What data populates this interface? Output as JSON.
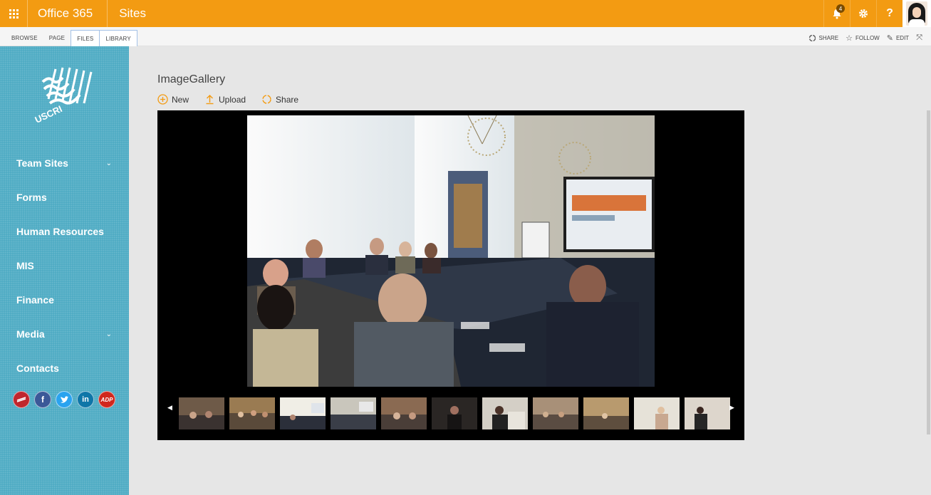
{
  "suitebar": {
    "brand": "Office 365",
    "app": "Sites",
    "notification_count": "4",
    "help_label": "?"
  },
  "ribbon": {
    "tabs": [
      "BROWSE",
      "PAGE",
      "FILES",
      "LIBRARY"
    ],
    "actions": {
      "share": "SHARE",
      "follow": "FOLLOW",
      "edit": "EDIT"
    }
  },
  "leftnav": {
    "logo_text": "USCRI",
    "items": [
      {
        "label": "Team Sites",
        "has_children": true
      },
      {
        "label": "Forms",
        "has_children": false
      },
      {
        "label": "Human Resources",
        "has_children": false
      },
      {
        "label": "MIS",
        "has_children": false
      },
      {
        "label": "Finance",
        "has_children": false
      },
      {
        "label": "Media",
        "has_children": true
      },
      {
        "label": "Contacts",
        "has_children": false
      }
    ],
    "chevron": "⌄",
    "socials": [
      "uscri-icon",
      "facebook-icon",
      "twitter-icon",
      "linkedin-icon",
      "adp-icon"
    ]
  },
  "main": {
    "title": "ImageGallery",
    "commands": {
      "new": "New",
      "upload": "Upload",
      "share": "Share"
    },
    "gallery": {
      "prev_arrow": "◀",
      "next_arrow": "▶",
      "thumbnail_count": 11
    }
  },
  "colors": {
    "suitebar": "#f39b12",
    "leftnav": "#4aa9c2",
    "viewer_bg": "#000000"
  }
}
